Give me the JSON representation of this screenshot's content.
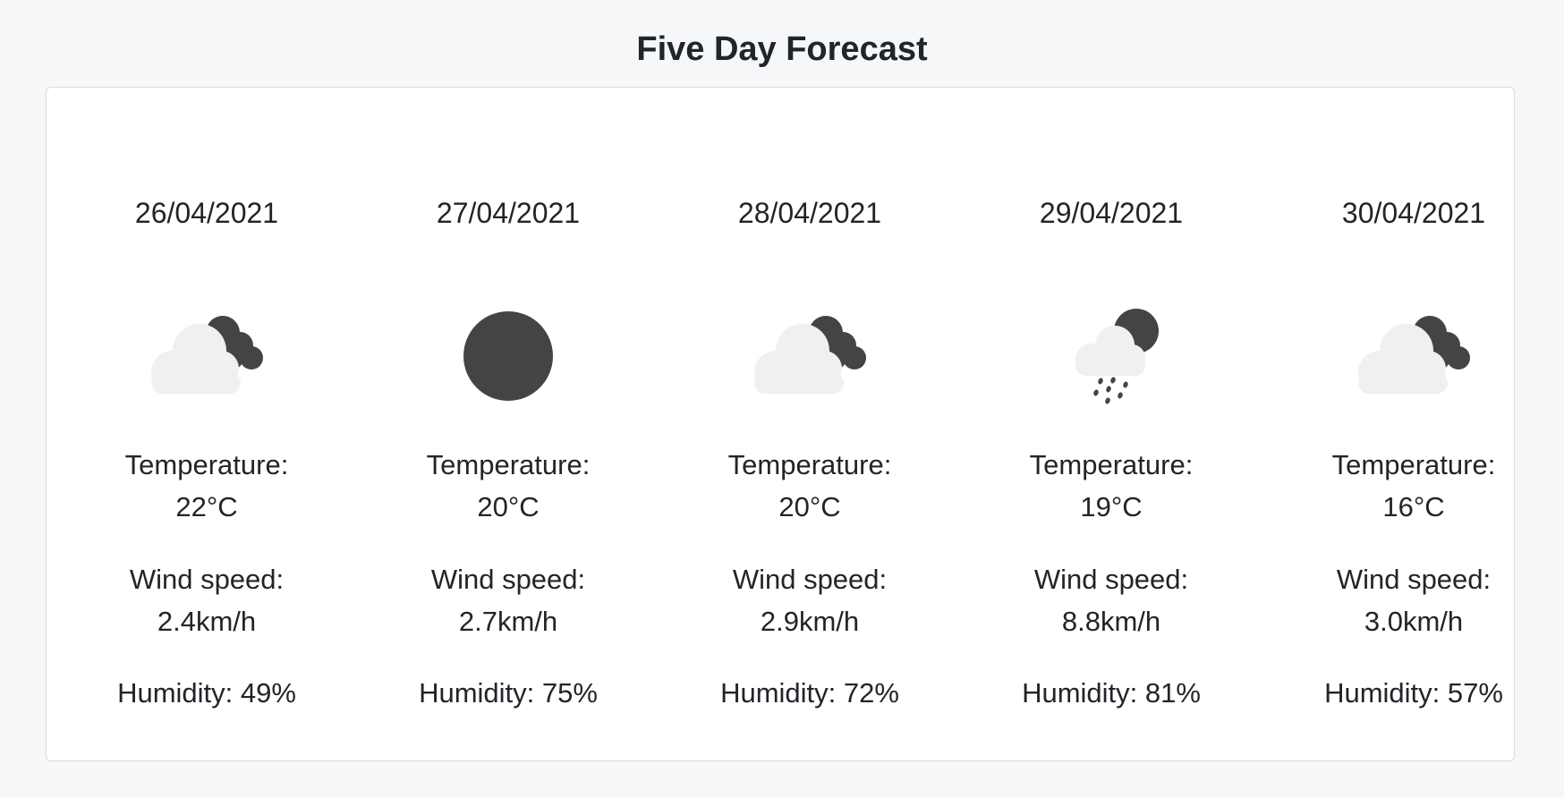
{
  "page": {
    "title": "Five Day Forecast"
  },
  "colors": {
    "background": "#f6f7f9",
    "card": "#ffffff",
    "cloud": "#f0f0f0",
    "dark": "#444444"
  },
  "forecast": [
    {
      "date": "26/04/2021",
      "icon": "partly-cloudy-night-icon",
      "temperature_label": "Temperature:",
      "temperature": "22°C",
      "wind_label": "Wind speed:",
      "wind": "2.4km/h",
      "humidity": "Humidity: 49%"
    },
    {
      "date": "27/04/2021",
      "icon": "clear-night-icon",
      "temperature_label": "Temperature:",
      "temperature": "20°C",
      "wind_label": "Wind speed:",
      "wind": "2.7km/h",
      "humidity": "Humidity: 75%"
    },
    {
      "date": "28/04/2021",
      "icon": "partly-cloudy-night-icon",
      "temperature_label": "Temperature:",
      "temperature": "20°C",
      "wind_label": "Wind speed:",
      "wind": "2.9km/h",
      "humidity": "Humidity: 72%"
    },
    {
      "date": "29/04/2021",
      "icon": "night-rain-icon",
      "temperature_label": "Temperature:",
      "temperature": "19°C",
      "wind_label": "Wind speed:",
      "wind": "8.8km/h",
      "humidity": "Humidity: 81%"
    },
    {
      "date": "30/04/2021",
      "icon": "partly-cloudy-night-icon",
      "temperature_label": "Temperature:",
      "temperature": "16°C",
      "wind_label": "Wind speed:",
      "wind": "3.0km/h",
      "humidity": "Humidity: 57%"
    }
  ]
}
